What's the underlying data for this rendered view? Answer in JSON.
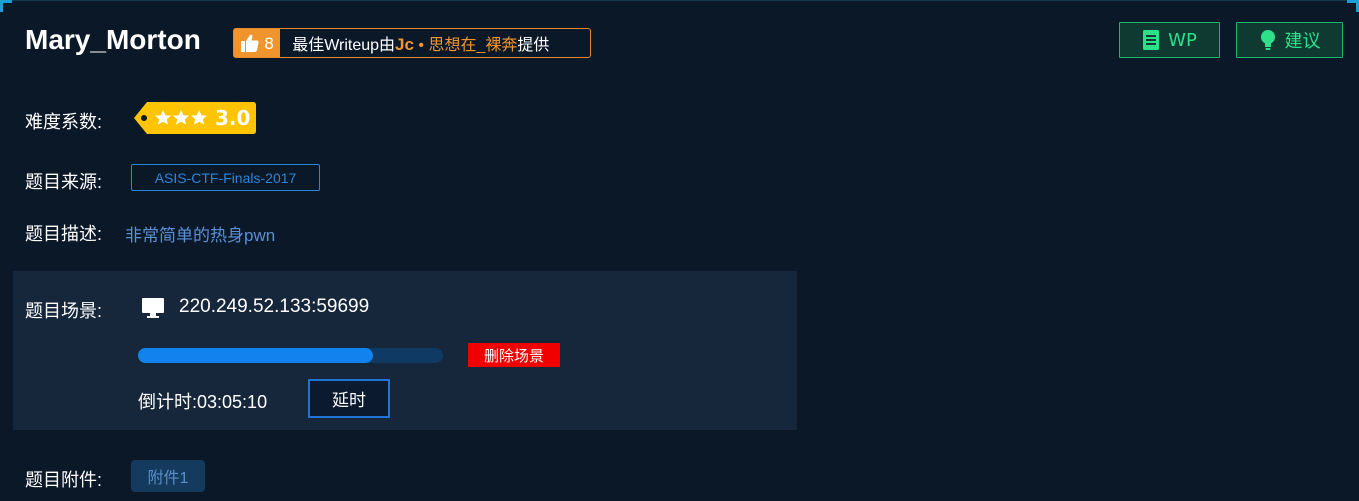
{
  "challenge": {
    "title": "Mary_Morton"
  },
  "writeup_badge": {
    "like_count": "8",
    "prefix": "最佳Writeup由",
    "author": "Jc",
    "separator": "•",
    "team": "思想在_裸奔",
    "suffix": "提供",
    "accent_color": "#f0952d"
  },
  "actions": {
    "wp_label": "WP",
    "advice_label": "建议",
    "wp_icon": "document-icon",
    "advice_icon": "lightbulb-icon",
    "accent_color": "#2ee08a"
  },
  "difficulty": {
    "label": "难度系数:",
    "stars": 3,
    "score": "3.0",
    "color": "#ffc400"
  },
  "source": {
    "label": "题目来源:",
    "value": "ASIS-CTF-Finals-2017"
  },
  "description": {
    "label": "题目描述:",
    "value": "非常简单的热身pwn"
  },
  "scene": {
    "label": "题目场景:",
    "address": "220.249.52.133:59699",
    "progress": 0.77,
    "delete_label": "删除场景",
    "countdown_label": "倒计时:",
    "countdown_value": "03:05:10",
    "extend_label": "延时"
  },
  "attachment": {
    "label": "题目附件:",
    "file_label": "附件1"
  }
}
